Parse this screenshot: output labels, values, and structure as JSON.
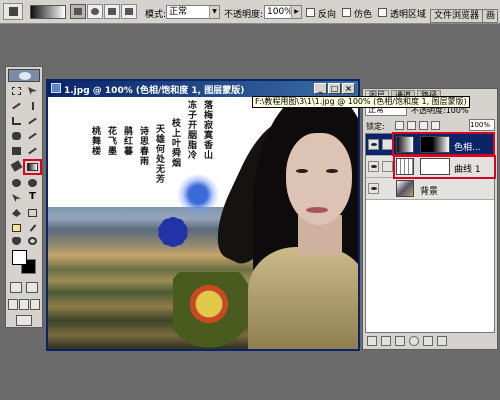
{
  "options_bar": {
    "mode_label": "模式:",
    "mode_value": "正常",
    "opacity_label": "不透明度:",
    "opacity_value": "100%",
    "reverse_label": "反向",
    "dither_label": "仿色",
    "transparency_label": "透明区域",
    "file_browser_label": "文件浏览器",
    "brushes_label": "画笔"
  },
  "document": {
    "title": "1.jpg @ 100% (色相/饱和度 1, 图层蒙版)",
    "calligraphy_columns": [
      "落梅寂寞香山",
      "冻子开胭脂冷",
      "枝上叶舜烟",
      "天雄何处无芳",
      "诗思春雨",
      "鹃红暮",
      "花飞墨",
      "桃舞楼"
    ],
    "tooltip": "F:\\教程用图\\3\\1\\1.jpg @ 100% (色相/饱和度 1, 图层蒙版)"
  },
  "layers_panel": {
    "tabs": [
      "图层",
      "通道",
      "路径"
    ],
    "blend_mode": "正常",
    "opacity_label": "不透明度:",
    "opacity_value": "100%",
    "lock_label": "锁定:",
    "fill_value": "100%",
    "layers": [
      {
        "name": "色相...",
        "selected": true
      },
      {
        "name": "曲线 1",
        "selected": false
      },
      {
        "name": "背景",
        "selected": false
      }
    ]
  },
  "colors": {
    "foreground": "#ffffff",
    "background": "#000000",
    "highlight": "#d90021",
    "title_bar": "#0a246a"
  }
}
